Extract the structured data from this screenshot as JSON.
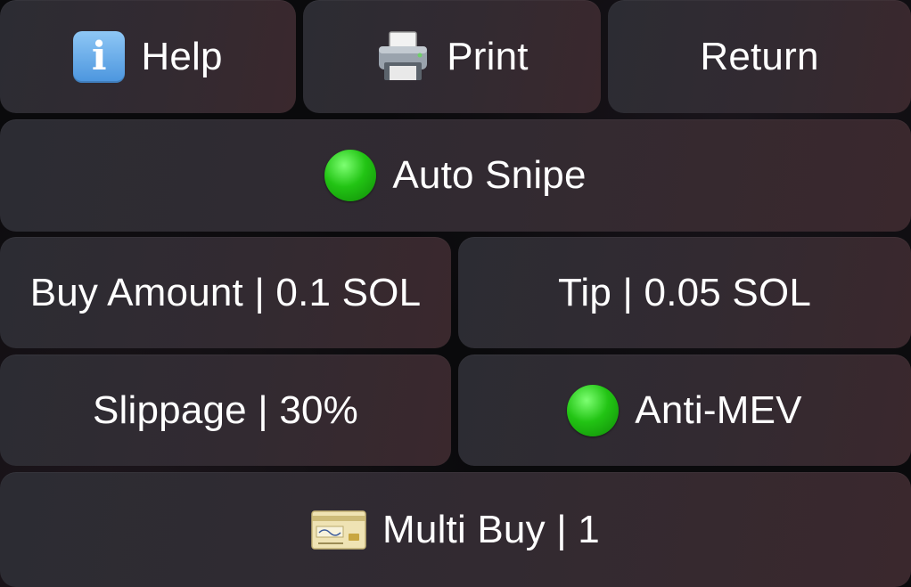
{
  "buttons": {
    "help": {
      "label": "Help",
      "icon": "info-icon"
    },
    "print": {
      "label": "Print",
      "icon": "printer-icon"
    },
    "return": {
      "label": "Return"
    },
    "auto_snipe": {
      "label": "Auto Snipe",
      "icon": "green-circle-icon",
      "status_color": "#22c414"
    },
    "buy_amount": {
      "label": "Buy Amount | 0.1 SOL"
    },
    "tip": {
      "label": "Tip | 0.05 SOL"
    },
    "slippage": {
      "label": "Slippage | 30%"
    },
    "anti_mev": {
      "label": "Anti-MEV",
      "icon": "green-circle-icon",
      "status_color": "#22c414"
    },
    "multi_buy": {
      "label": "Multi Buy | 1",
      "icon": "credit-card-icon"
    }
  },
  "colors": {
    "button_bg": "#2f2a31",
    "text": "#ffffff",
    "background": "#0a0a0c"
  }
}
